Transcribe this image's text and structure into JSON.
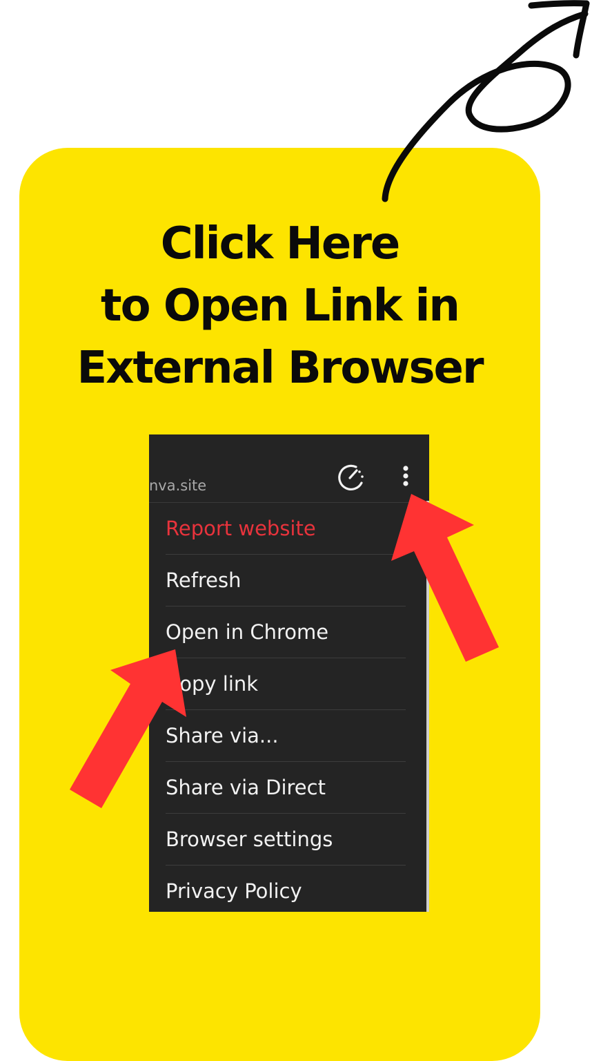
{
  "headline": {
    "line1": "Click Here",
    "line2": "to Open Link in",
    "line3": "External Browser"
  },
  "browser": {
    "url_fragment": "nva.site",
    "menu_items": [
      {
        "label": "Report website",
        "style": "danger"
      },
      {
        "label": "Refresh"
      },
      {
        "label": "Open in Chrome"
      },
      {
        "label": "Copy link"
      },
      {
        "label": "Share via..."
      },
      {
        "label": "Share via Direct"
      },
      {
        "label": "Browser settings"
      },
      {
        "label": "Privacy Policy"
      }
    ],
    "icons": {
      "speed": "speed-gauge-icon",
      "more": "more-vertical-icon"
    }
  },
  "colors": {
    "card": "#fde400",
    "menu_bg": "#242424",
    "danger_text": "#e8333c",
    "arrow": "#ff3333",
    "headline": "#0a0a0a"
  }
}
